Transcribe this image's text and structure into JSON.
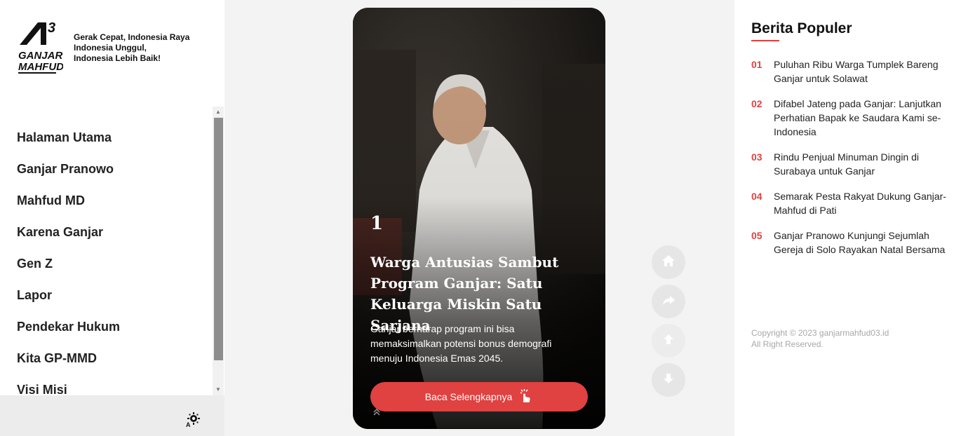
{
  "brand": {
    "logo_text_top": "GANJAR",
    "logo_text_bottom": "MAHFUD",
    "logo_number": "3",
    "tagline": [
      "Gerak Cepat, Indonesia Raya",
      "Indonesia Unggul,",
      "Indonesia Lebih Baik!"
    ]
  },
  "nav": {
    "items": [
      {
        "label": "Halaman Utama"
      },
      {
        "label": "Ganjar Pranowo"
      },
      {
        "label": "Mahfud MD"
      },
      {
        "label": "Karena Ganjar"
      },
      {
        "label": "Gen Z"
      },
      {
        "label": "Lapor"
      },
      {
        "label": "Pendekar Hukum"
      },
      {
        "label": "Kita GP-MMD"
      },
      {
        "label": "Visi Misi"
      }
    ]
  },
  "theme_toggle": {
    "icon": "brightness-auto-icon"
  },
  "story": {
    "number": "1",
    "title": "Warga Antusias Sambut Program Ganjar: Satu Keluarga Miskin Satu Sarjana",
    "description": "Ganjar berharap program ini bisa memaksimalkan potensi bonus demografi menuju Indonesia Emas 2045.",
    "cta_label": "Baca Selengkapnya",
    "cta_icon": "tap-hand-icon",
    "swipe_hint_icon": "double-chevron-up-icon"
  },
  "actions": [
    {
      "name": "home",
      "icon": "home-icon",
      "enabled": true
    },
    {
      "name": "share",
      "icon": "share-icon",
      "enabled": true
    },
    {
      "name": "prev",
      "icon": "arrow-up-icon",
      "enabled": false
    },
    {
      "name": "next",
      "icon": "arrow-down-icon",
      "enabled": true
    }
  ],
  "popular": {
    "title": "Berita Populer",
    "items": [
      {
        "num": "01",
        "text": "Puluhan Ribu Warga Tumplek Bareng Ganjar untuk Solawat"
      },
      {
        "num": "02",
        "text": "Difabel Jateng pada Ganjar: Lanjutkan Perhatian Bapak ke Saudara Kami se-Indonesia"
      },
      {
        "num": "03",
        "text": "Rindu Penjual Minuman Dingin di Surabaya untuk Ganjar"
      },
      {
        "num": "04",
        "text": "Semarak Pesta Rakyat Dukung Ganjar-Mahfud di Pati"
      },
      {
        "num": "05",
        "text": "Ganjar Pranowo Kunjungi Sejumlah Gereja di Solo Rayakan Natal Bersama"
      }
    ]
  },
  "footer": {
    "copyright": "Copyright © 2023 ganjarmahfud03.id",
    "rights": "All Right Reserved."
  },
  "colors": {
    "accent": "#e04141",
    "card_bg": "#1b1714",
    "page_bg": "#f3f3f3"
  }
}
